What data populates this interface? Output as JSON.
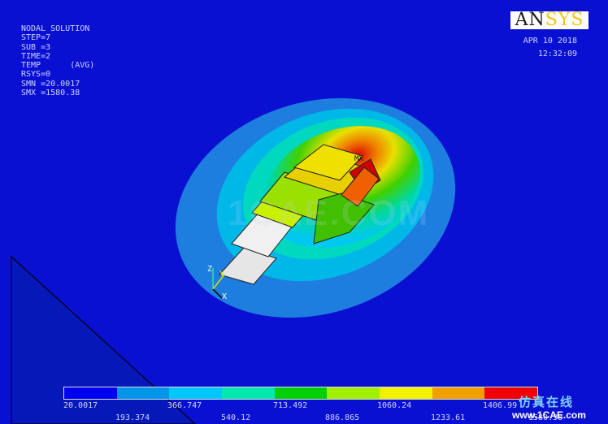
{
  "solution": {
    "lines": [
      "NODAL SOLUTION",
      "STEP=7",
      "SUB =3",
      "TIME=2",
      "TEMP      (AVG)",
      "RSYS=0",
      "SMN =20.0017",
      "SMX =1580.38"
    ]
  },
  "brand": {
    "an": "AN",
    "sys": "SYS"
  },
  "datetime": {
    "date": "APR 10 2018",
    "time": "12:32:09"
  },
  "model": {
    "max_label": "MX",
    "watermark": "1CAE.COM"
  },
  "axes": {
    "z": "Z",
    "y": "Y",
    "x": "X"
  },
  "legend": {
    "colors": [
      "#0000f0",
      "#0095e8",
      "#00c8ff",
      "#00e8b0",
      "#00d000",
      "#a0f000",
      "#f0f000",
      "#f0a000",
      "#f00000"
    ],
    "labels_top": [
      "20.0017",
      "366.747",
      "713.492",
      "1060.24",
      "1406.99"
    ],
    "labels_bottom": [
      "193.374",
      "540.12",
      "886.865",
      "1233.61",
      "1580.38"
    ]
  },
  "corner_brand": {
    "cn": "仿真在线",
    "url": "www.1CAE.com"
  }
}
